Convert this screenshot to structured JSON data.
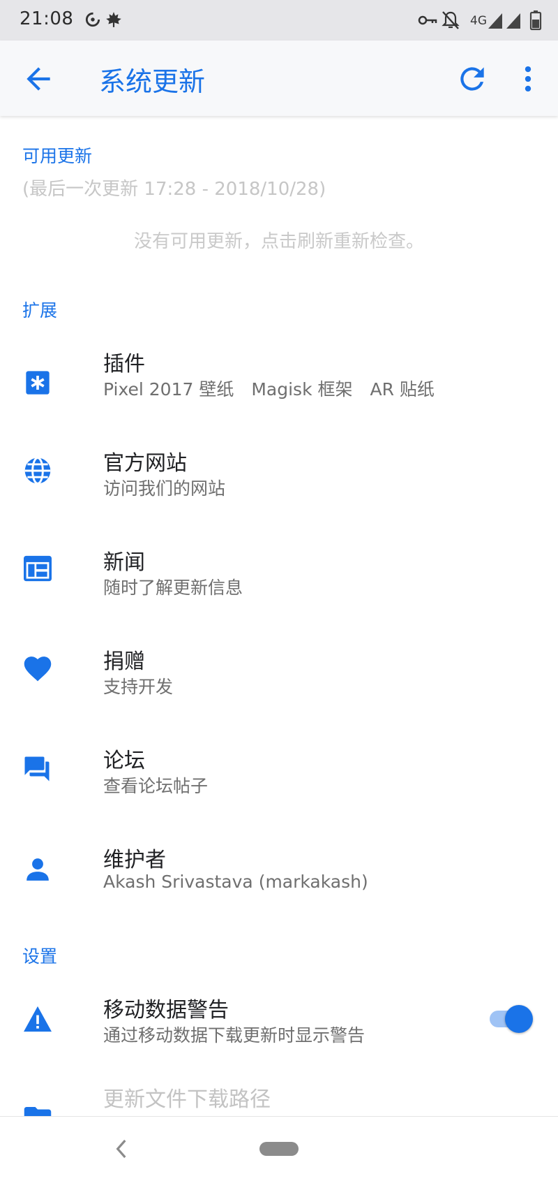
{
  "status_bar": {
    "time": "21:08",
    "network": "4G",
    "icons": [
      "data-saver-icon",
      "maple-leaf-icon",
      "vpn-key-icon",
      "notifications-off-icon",
      "signal-icon",
      "signal-icon",
      "battery-icon"
    ]
  },
  "app_bar": {
    "title": "系统更新",
    "back_icon": "arrow-back-icon",
    "refresh_icon": "refresh-icon",
    "more_icon": "more-vert-icon"
  },
  "available_updates": {
    "header": "可用更新",
    "last_update": "(最后一次更新 17:28 - 2018/10/28)",
    "empty_message": "没有可用更新，点击刷新重新检查。"
  },
  "extensions": {
    "header": "扩展",
    "items": [
      {
        "icon": "addon-icon",
        "title": "插件",
        "subtitle": "Pixel 2017 壁纸　Magisk 框架　AR 贴纸"
      },
      {
        "icon": "globe-icon",
        "title": "官方网站",
        "subtitle": "访问我们的网站"
      },
      {
        "icon": "news-icon",
        "title": "新闻",
        "subtitle": "随时了解更新信息"
      },
      {
        "icon": "heart-icon",
        "title": "捐赠",
        "subtitle": "支持开发"
      },
      {
        "icon": "forum-icon",
        "title": "论坛",
        "subtitle": "查看论坛帖子"
      },
      {
        "icon": "person-icon",
        "title": "维护者",
        "subtitle": "Akash Srivastava (markakash)"
      }
    ]
  },
  "settings": {
    "header": "设置",
    "items": [
      {
        "icon": "warning-icon",
        "title": "移动数据警告",
        "subtitle": "通过移动数据下载更新时显示警告",
        "toggle_on": true
      },
      {
        "icon": "folder-icon",
        "title": "更新文件下载路径"
      }
    ]
  },
  "colors": {
    "accent": "#1a73e8",
    "status_bar": "#e6e6e9",
    "app_bar": "#f7f8fa"
  }
}
